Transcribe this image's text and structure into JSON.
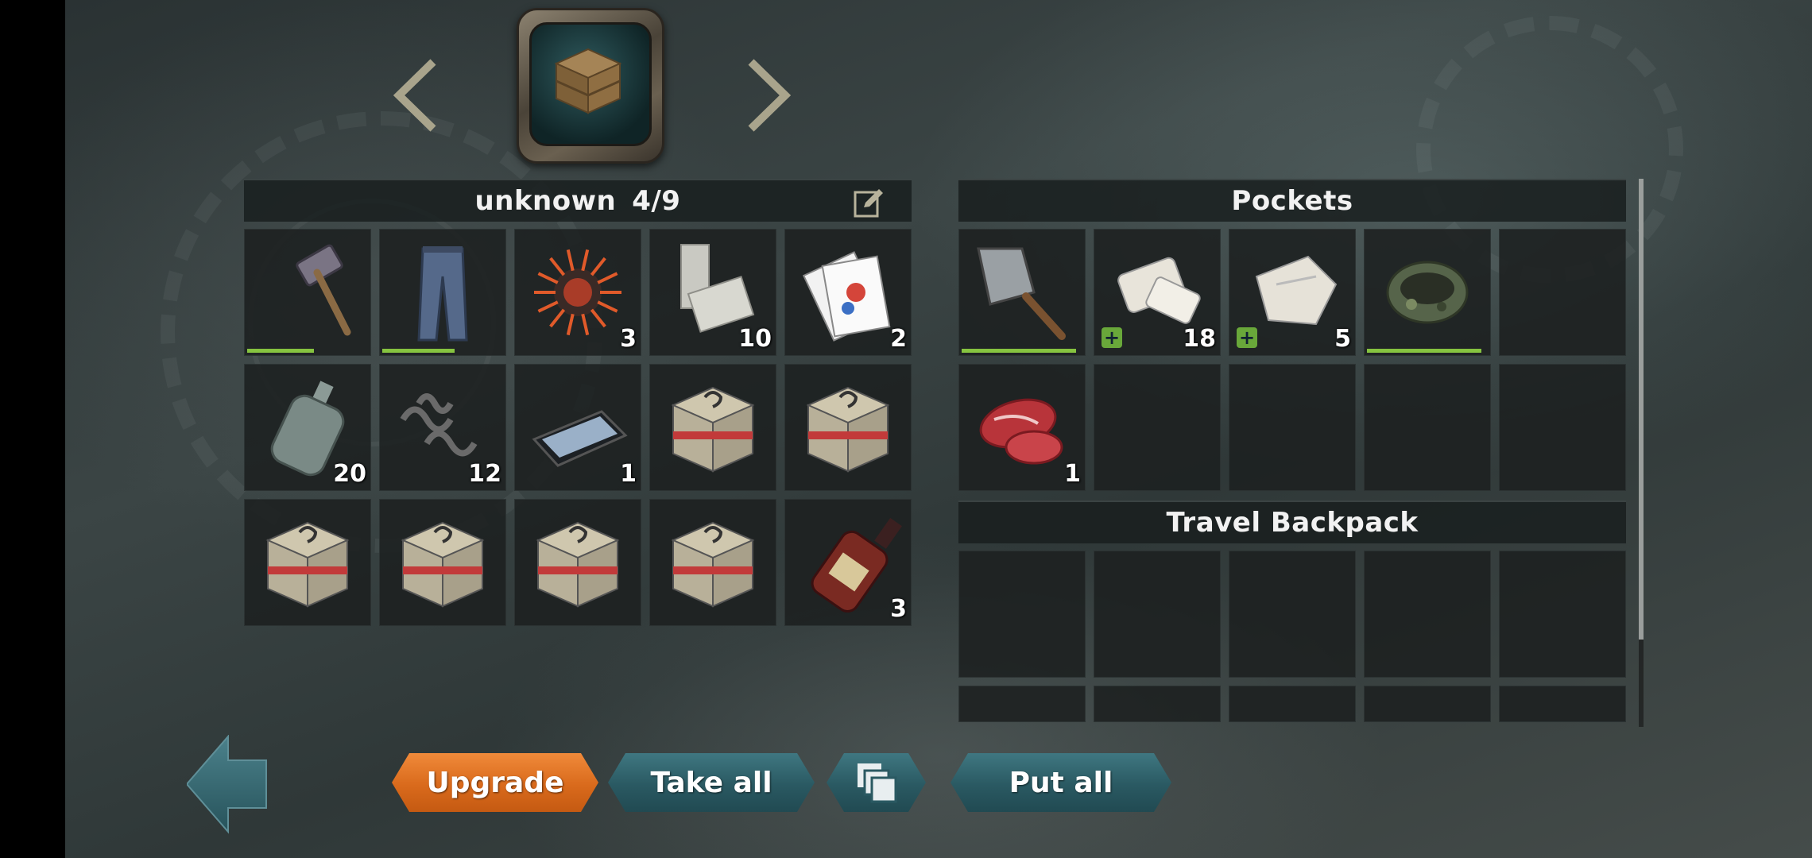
{
  "container": {
    "name": "unknown",
    "capacity": "4/9",
    "items": [
      {
        "icon": "sledgehammer-icon",
        "count": "",
        "durability": 0.55
      },
      {
        "icon": "jeans-icon",
        "count": "",
        "durability": 0.6
      },
      {
        "icon": "explosive-spikes-icon",
        "count": "3"
      },
      {
        "icon": "stone-blocks-icon",
        "count": "10"
      },
      {
        "icon": "playing-cards-icon",
        "count": "2"
      },
      {
        "icon": "glass-bottle-icon",
        "count": "20"
      },
      {
        "icon": "metal-shavings-icon",
        "count": "12"
      },
      {
        "icon": "tablet-icon",
        "count": "1"
      },
      {
        "icon": "mystery-crate-icon",
        "count": ""
      },
      {
        "icon": "mystery-crate-icon",
        "count": ""
      },
      {
        "icon": "mystery-crate-icon",
        "count": ""
      },
      {
        "icon": "mystery-crate-icon",
        "count": ""
      },
      {
        "icon": "mystery-crate-icon",
        "count": ""
      },
      {
        "icon": "mystery-crate-icon",
        "count": ""
      },
      {
        "icon": "liquor-bottle-icon",
        "count": "3"
      }
    ]
  },
  "pockets": {
    "title": "Pockets",
    "items": [
      {
        "icon": "cleaver-icon",
        "count": "",
        "durability": 0.95
      },
      {
        "icon": "bandage-icon",
        "count": "18",
        "medical": true
      },
      {
        "icon": "cloth-rag-icon",
        "count": "5",
        "medical": true
      },
      {
        "icon": "camo-bandana-icon",
        "count": "",
        "durability": 0.95
      },
      {
        "icon": "",
        "count": ""
      },
      {
        "icon": "raw-meat-icon",
        "count": "1"
      },
      {
        "icon": "",
        "count": ""
      },
      {
        "icon": "",
        "count": ""
      },
      {
        "icon": "",
        "count": ""
      },
      {
        "icon": "",
        "count": ""
      }
    ]
  },
  "backpack": {
    "title": "Travel Backpack"
  },
  "buttons": {
    "upgrade": "Upgrade",
    "take_all": "Take all",
    "put_all": "Put all"
  },
  "colors": {
    "accent_orange": "#d96a1c",
    "button_teal": "#2a5962",
    "durability_green": "#86c440",
    "medical_green": "#69a83a"
  }
}
